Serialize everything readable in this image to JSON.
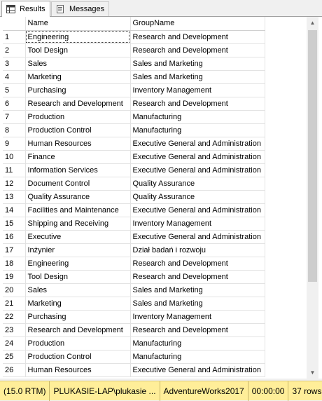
{
  "tabs": [
    {
      "label": "Results",
      "icon": "grid-icon",
      "active": true
    },
    {
      "label": "Messages",
      "icon": "messages-icon",
      "active": false
    }
  ],
  "grid": {
    "columns": [
      "Name",
      "GroupName"
    ],
    "rows": [
      {
        "n": "1",
        "name": "Engineering",
        "group": "Research and Development"
      },
      {
        "n": "2",
        "name": "Tool Design",
        "group": "Research and Development"
      },
      {
        "n": "3",
        "name": "Sales",
        "group": "Sales and Marketing"
      },
      {
        "n": "4",
        "name": "Marketing",
        "group": "Sales and Marketing"
      },
      {
        "n": "5",
        "name": "Purchasing",
        "group": "Inventory Management"
      },
      {
        "n": "6",
        "name": "Research and Development",
        "group": "Research and Development"
      },
      {
        "n": "7",
        "name": "Production",
        "group": "Manufacturing"
      },
      {
        "n": "8",
        "name": "Production Control",
        "group": "Manufacturing"
      },
      {
        "n": "9",
        "name": "Human Resources",
        "group": "Executive General and Administration"
      },
      {
        "n": "10",
        "name": "Finance",
        "group": "Executive General and Administration"
      },
      {
        "n": "11",
        "name": "Information Services",
        "group": "Executive General and Administration"
      },
      {
        "n": "12",
        "name": "Document Control",
        "group": "Quality Assurance"
      },
      {
        "n": "13",
        "name": "Quality Assurance",
        "group": "Quality Assurance"
      },
      {
        "n": "14",
        "name": "Facilities and Maintenance",
        "group": "Executive General and Administration"
      },
      {
        "n": "15",
        "name": "Shipping and Receiving",
        "group": "Inventory Management"
      },
      {
        "n": "16",
        "name": "Executive",
        "group": "Executive General and Administration"
      },
      {
        "n": "17",
        "name": "Inżynier",
        "group": "Dział badań i rozwoju"
      },
      {
        "n": "18",
        "name": "Engineering",
        "group": "Research and Development"
      },
      {
        "n": "19",
        "name": "Tool Design",
        "group": "Research and Development"
      },
      {
        "n": "20",
        "name": "Sales",
        "group": "Sales and Marketing"
      },
      {
        "n": "21",
        "name": "Marketing",
        "group": "Sales and Marketing"
      },
      {
        "n": "22",
        "name": "Purchasing",
        "group": "Inventory Management"
      },
      {
        "n": "23",
        "name": "Research and Development",
        "group": "Research and Development"
      },
      {
        "n": "24",
        "name": "Production",
        "group": "Manufacturing"
      },
      {
        "n": "25",
        "name": "Production Control",
        "group": "Manufacturing"
      },
      {
        "n": "26",
        "name": "Human Resources",
        "group": "Executive General and Administration"
      }
    ]
  },
  "status": {
    "version": "(15.0 RTM)",
    "server": "PLUKASIE-LAP\\plukasie ...",
    "database": "AdventureWorks2017",
    "elapsed": "00:00:00",
    "rows": "37 rows"
  },
  "colors": {
    "status_bg": "#ffee99",
    "selection_border": "#333333"
  }
}
